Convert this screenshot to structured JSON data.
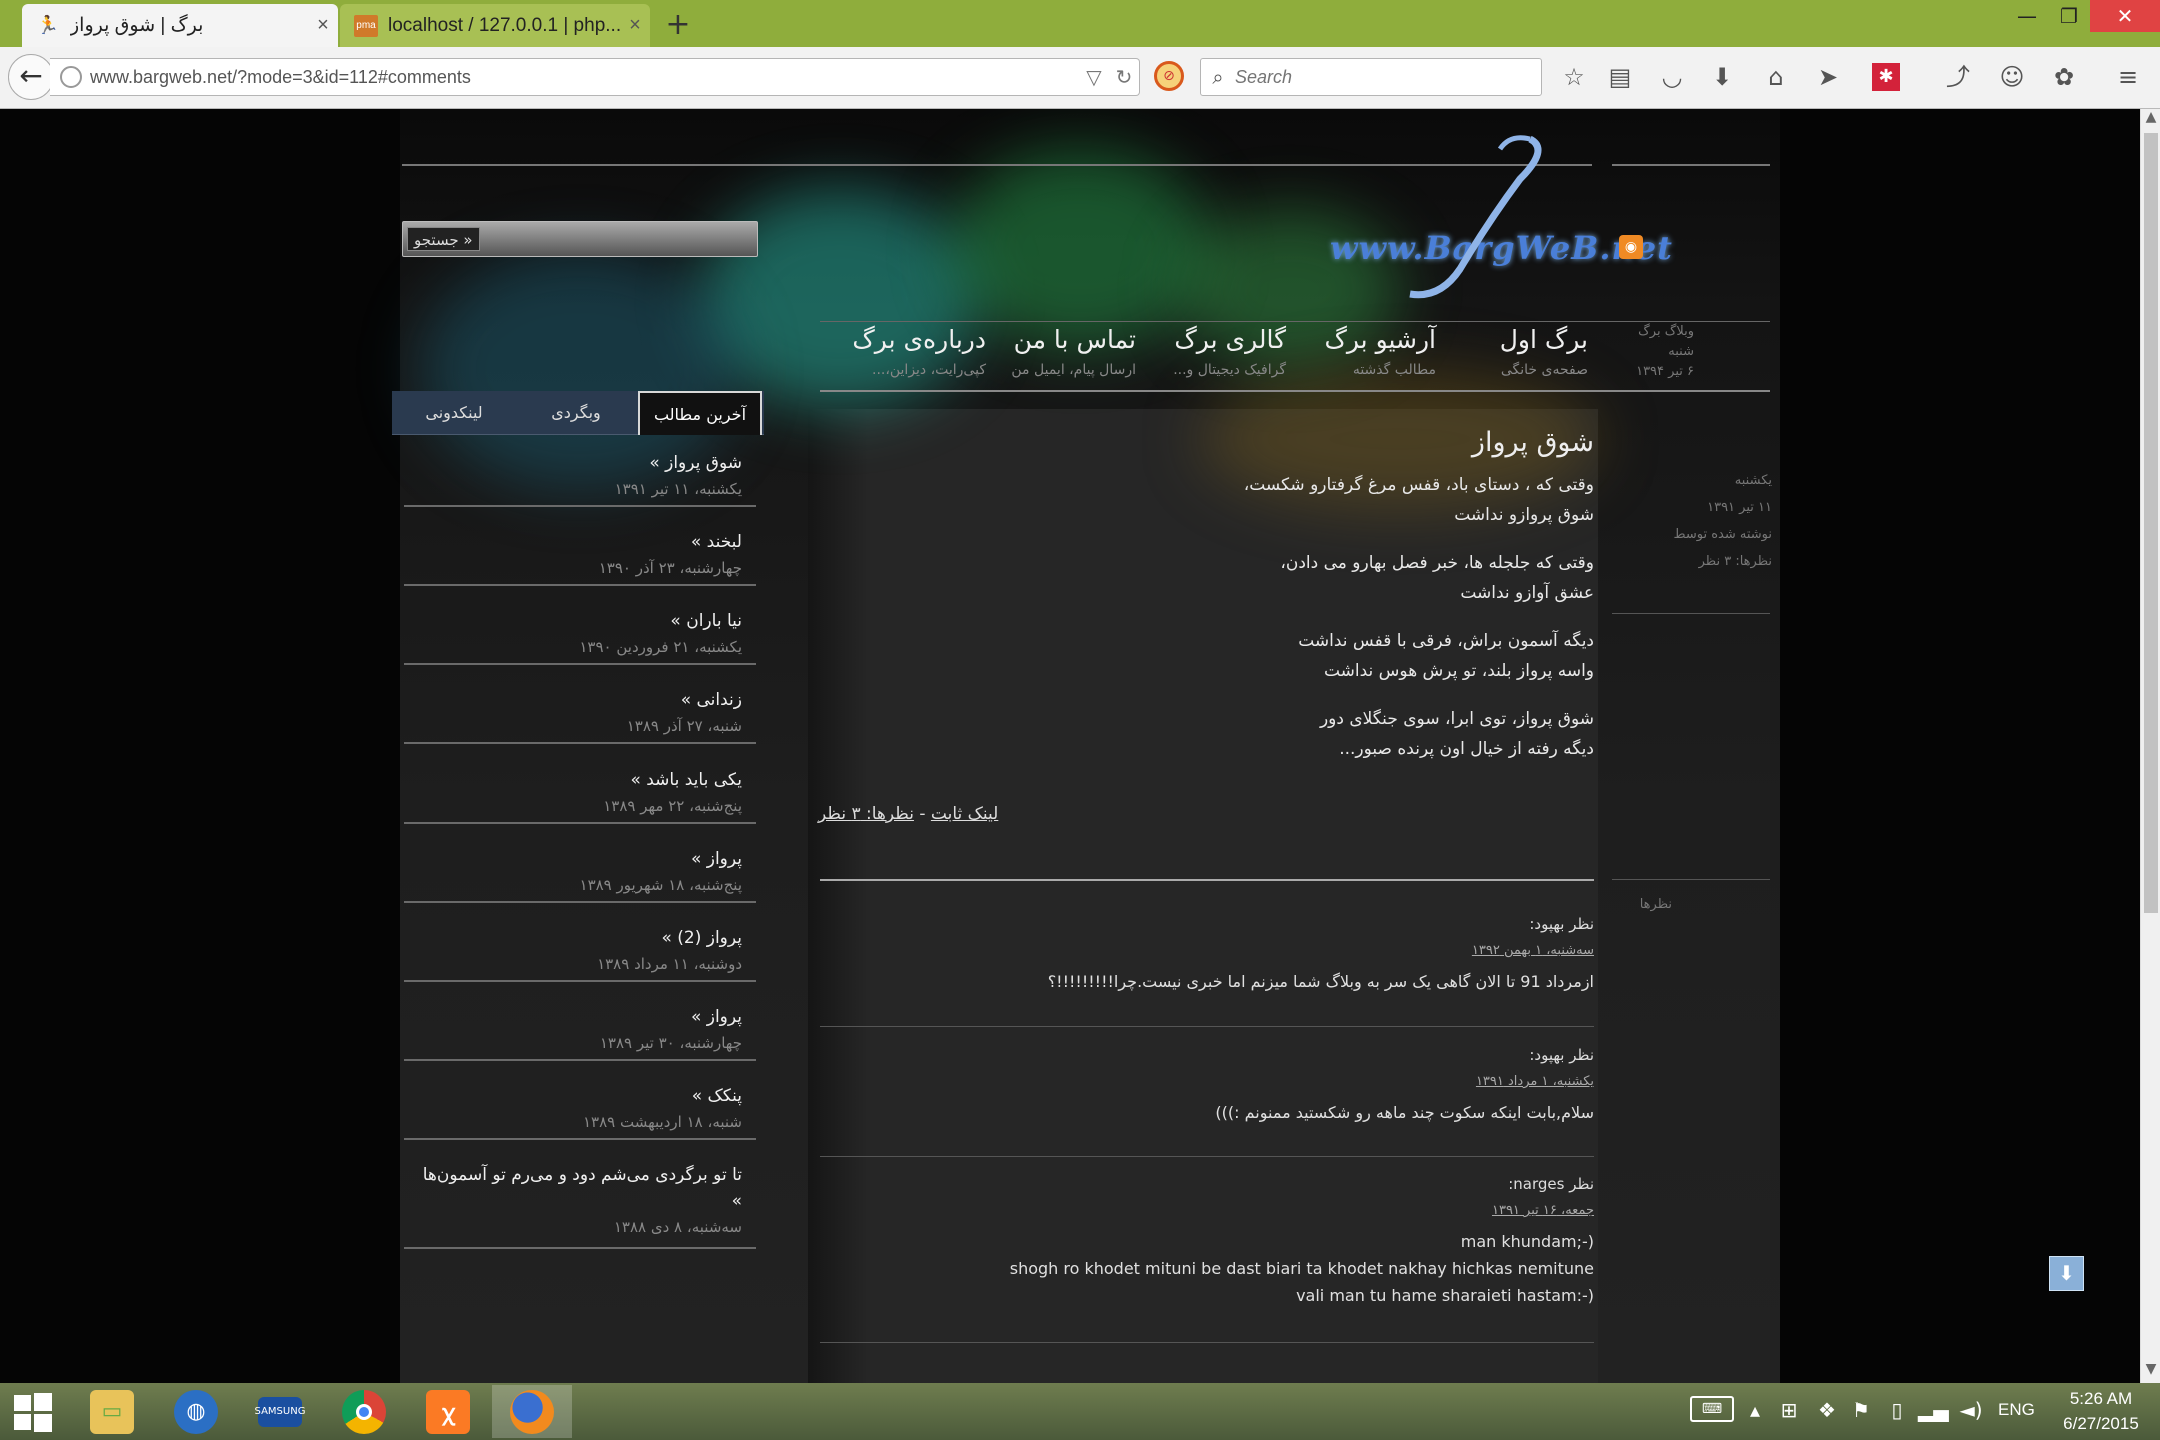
{
  "browser": {
    "tabs": [
      {
        "label": "برگ | شوق پرواز",
        "close": "×"
      },
      {
        "label": "localhost / 127.0.0.1 | php...",
        "close": "×"
      }
    ],
    "new_tab": "+",
    "url": "www.bargweb.net/?mode=3&id=112#comments",
    "search_placeholder": "Search",
    "window_controls": {
      "minimize": "—",
      "restore": "❐",
      "close": "✕"
    }
  },
  "site": {
    "logo": "www.BargWeB.net",
    "search_button": "جستجو »",
    "nav": [
      {
        "title": "برگ اول",
        "subtitle": "صفحه‌ی خانگی"
      },
      {
        "title": "آرشیو برگ",
        "subtitle": "مطالب گذشته"
      },
      {
        "title": "گالری برگ",
        "subtitle": "گرافیک دیجیتال و..."
      },
      {
        "title": "تماس با من",
        "subtitle": "ارسال پیام، ایمیل من"
      },
      {
        "title": "درباره‌ی برگ",
        "subtitle": "کپی‌رایت، دیزاین،..."
      }
    ],
    "header_meta": [
      "وبلاگ برگ",
      "شنبه",
      "۶ تیر ۱۳۹۴"
    ]
  },
  "post": {
    "title": "شوق پرواز",
    "stanzas": [
      [
        "وقتی که ، دستای باد، قفس مرغ گرفتارو شکست،",
        "شوق پروازو نداشت"
      ],
      [
        "وقتی که جلجله ها، خبر فصل بهارو می دادن،",
        "عشق آوازو نداشت"
      ],
      [
        "دیگه آسمون براش، فرقی با قفس نداشت",
        "واسه پرواز بلند، تو پرش هوس نداشت"
      ],
      [
        "شوق پرواز، توی ابرا، سوی جنگلای دور",
        "دیگه رفته از خیال اون پرنده صبور..."
      ]
    ],
    "meta": [
      "یکشنبه",
      "۱۱ تیر ۱۳۹۱",
      "نوشته شده توسط",
      "نظرها: ۳ نظر"
    ],
    "permalink": "لینک ثابت",
    "separator": " - ",
    "comments_count": "نظرها: ۳ نظر",
    "comments_heading": "نظرها"
  },
  "comments": [
    {
      "author": "نظر بهپود:",
      "date": "سه‌شنبه، ۱ بهمن ۱۳۹۲",
      "lines": [
        "ازمرداد 91 تا الان گاهی یک سر به وبلاگ شما میزنم اما خبری نیست.چرا!!!!!!!!!؟"
      ]
    },
    {
      "author": "نظر بهپود:",
      "date": "یکشنبه، ۱ مرداد ۱۳۹۱",
      "lines": [
        "سلام,بابت اینکه سکوت چند ماهه رو شکستید ممنونم :)))"
      ]
    },
    {
      "author": "نظر narges:",
      "date": "جمعه، ۱۶ تیر ۱۳۹۱",
      "lines": [
        "(-;man khundam",
        "shogh ro khodet mituni be dast biari ta khodet nakhay hichkas nemitune",
        "(-:vali man tu hame sharaieti hastam"
      ]
    }
  ],
  "sidebar": {
    "tabs": [
      "آخرین مطالب",
      "وبگردی",
      "لینکدونی"
    ],
    "items": [
      {
        "title": "شوق پرواز »",
        "date": "یکشنبه، ۱۱ تیر ۱۳۹۱"
      },
      {
        "title": "لبخند »",
        "date": "چهارشنبه، ۲۳ آذر ۱۳۹۰"
      },
      {
        "title": "نیا باران »",
        "date": "یکشنبه، ۲۱ فروردین ۱۳۹۰"
      },
      {
        "title": "زندانی »",
        "date": "شنبه، ۲۷ آذر ۱۳۸۹"
      },
      {
        "title": "یکی باید باشد »",
        "date": "پنج‌شنبه، ۲۲ مهر ۱۳۸۹"
      },
      {
        "title": "پرواز »",
        "date": "پنج‌شنبه، ۱۸ شهریور ۱۳۸۹"
      },
      {
        "title": "پرواز (2) »",
        "date": "دوشنبه، ۱۱ مرداد ۱۳۸۹"
      },
      {
        "title": "پرواز »",
        "date": "چهارشنبه، ۳۰ تیر ۱۳۸۹"
      },
      {
        "title": "پنکک »",
        "date": "شنبه، ۱۸ اردیبهشت ۱۳۸۹"
      },
      {
        "title": "تا تو برگردی می‌شم دود و می‌رم تو آسمون‌ها »",
        "date": "سه‌شنبه، ۸ دی ۱۳۸۸"
      }
    ]
  },
  "taskbar": {
    "apps": [
      "windows-start",
      "file-explorer",
      "internet-explorer",
      "samsung-app",
      "chrome",
      "xampp",
      "firefox"
    ],
    "language": "ENG",
    "time": "5:26 AM",
    "date": "6/27/2015"
  },
  "colors": {
    "titlebar": "#8fad3c",
    "page_bg": "#050505",
    "accent_rss": "#f08a24"
  }
}
